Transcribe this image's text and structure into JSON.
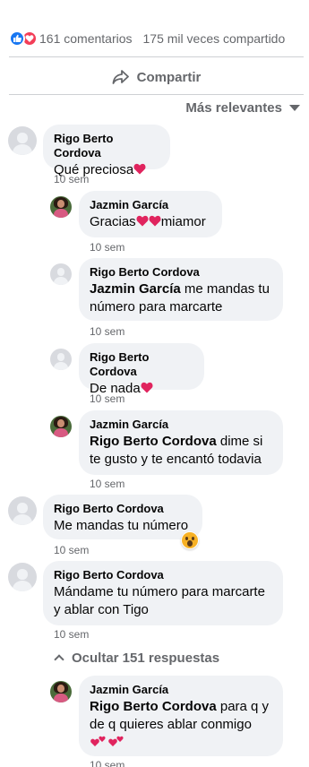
{
  "stats": {
    "comments": "161 comentarios",
    "shares": "175 mil veces compartido"
  },
  "share": {
    "label": "Compartir"
  },
  "sort": {
    "label": "Más relevantes"
  },
  "comments": [
    {
      "author": "Rigo Berto Cordova",
      "text": "Qué preciosa",
      "time": "10 sem"
    },
    {
      "author": "Jazmin García",
      "text_before": "Gracias",
      "text_after": "miamor",
      "time": "10 sem"
    },
    {
      "author": "Rigo Berto Cordova",
      "mention": "Jazmin García",
      "text": " me mandas tu número para marcarte",
      "time": "10 sem"
    },
    {
      "author": "Rigo Berto Cordova",
      "text": "De nada",
      "time": "10 sem"
    },
    {
      "author": "Jazmin García",
      "mention": "Rigo Berto Cordova",
      "text": " dime si te gusto y te encantó todavia",
      "time": "10 sem"
    },
    {
      "author": "Rigo Berto Cordova",
      "text": "Me mandas tu número",
      "time": "10 sem"
    },
    {
      "author": "Rigo Berto Cordova",
      "text": "Mándame tu número para marcarte y ablar con Tigo",
      "time": "10 sem"
    },
    {
      "author": "Jazmin García",
      "mention": "Rigo Berto Cordova",
      "text": " para q y de q quieres ablar conmigo",
      "time": "10 sem"
    }
  ],
  "replies_toggle": {
    "label": "Ocultar 151 respuestas"
  },
  "colors": {
    "like": "#1877f2",
    "love": "#f33e58",
    "bubble": "#f0f2f5",
    "muted": "#65676b"
  },
  "icons": [
    "like-reaction-icon",
    "love-reaction-icon",
    "share-arrow-icon",
    "caret-down-icon",
    "heart-icon",
    "wow-emoji-icon",
    "chevron-up-icon"
  ]
}
